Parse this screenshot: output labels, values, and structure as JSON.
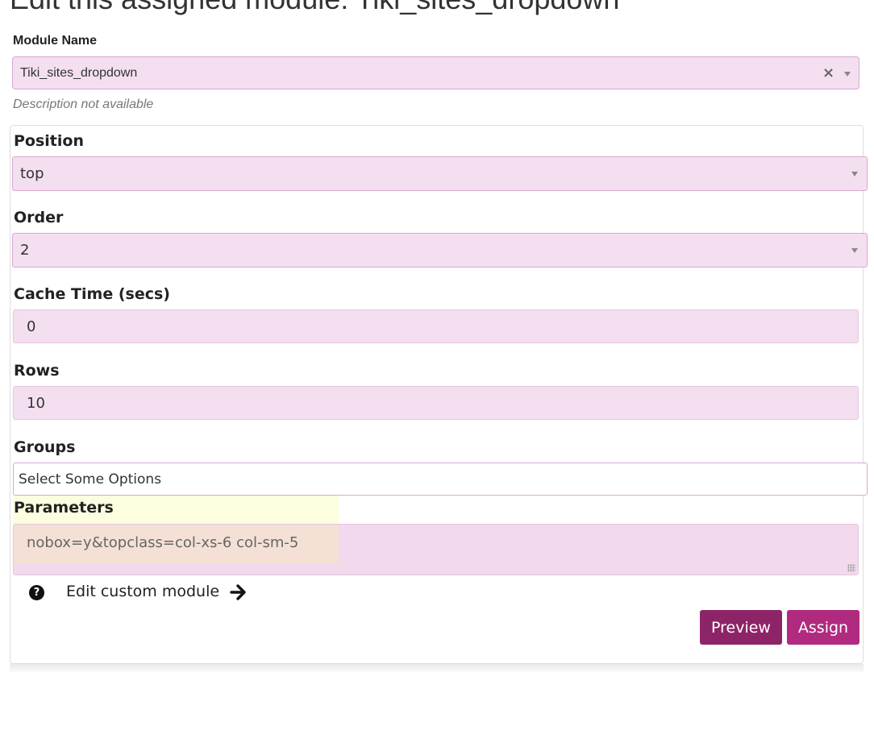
{
  "page": {
    "title": "Edit this assigned module: Tiki_sites_dropdown"
  },
  "module_name": {
    "label": "Module Name",
    "value": "Tiki_sites_dropdown",
    "description": "Description not available"
  },
  "form": {
    "position": {
      "label": "Position",
      "value": "top"
    },
    "order": {
      "label": "Order",
      "value": "2"
    },
    "cache_time": {
      "label": "Cache Time (secs)",
      "value": "0"
    },
    "rows": {
      "label": "Rows",
      "value": "10"
    },
    "groups": {
      "label": "Groups",
      "placeholder": "Select Some Options"
    },
    "parameters": {
      "label": "Parameters",
      "value": "nobox=y&topclass=col-xs-6 col-sm-5"
    },
    "edit_custom_module": "Edit custom module",
    "preview_label": "Preview",
    "assign_label": "Assign"
  },
  "icons": {
    "clear": "close-icon",
    "dropdown": "caret-down-icon",
    "help": "question-circle-icon",
    "edit_arrow": "arrow-right-icon",
    "resize": "resize-grip-icon"
  },
  "colors": {
    "field_bg": "#f4dff0",
    "field_border": "#d9a8cf",
    "preview_button": "#8e2468",
    "assign_button": "#b02a7f",
    "highlight": "#fdfde0"
  }
}
